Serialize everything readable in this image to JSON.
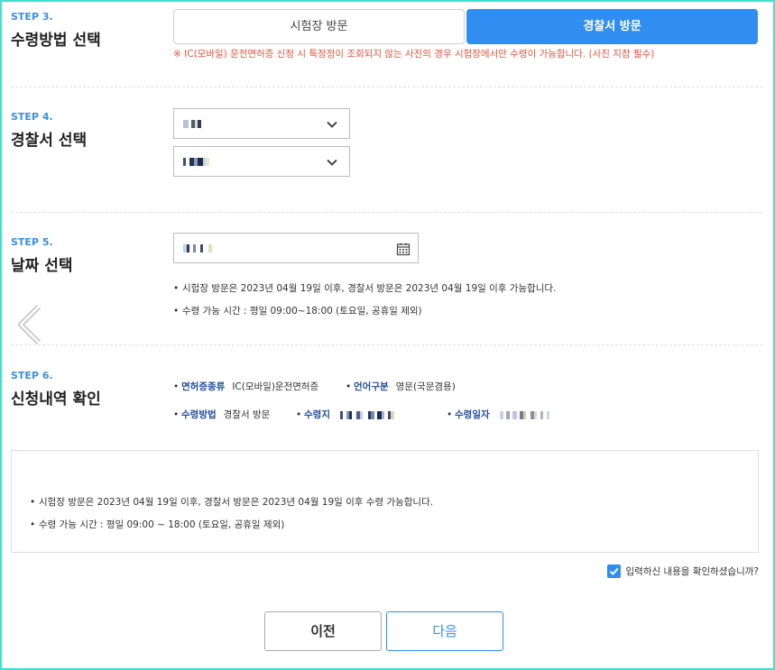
{
  "step3": {
    "label": "STEP 3.",
    "title": "수령방법 선택",
    "option_exam": "시험장 방문",
    "option_police": "경찰서 방문",
    "notice": "※ IC(모바일) 운전면허증 신청 시 특정점이 조회되지 않는 사진의 경우 시험장에서만 수령이 가능합니다. (사진 지참 필수)"
  },
  "step4": {
    "label": "STEP 4.",
    "title": "경찰서 선택"
  },
  "step5": {
    "label": "STEP 5.",
    "title": "날짜 선택",
    "info1": "시험장 방문은 2023년 04월 19일 이후, 경찰서 방문은 2023년 04월 19일 이후 가능합니다.",
    "info2": "수령 가능 시간 : 평일 09:00~18:00 (토요일, 공휴일 제외)"
  },
  "step6": {
    "label": "STEP 6.",
    "title": "신청내역 확인",
    "license_type_label": "면허증종류",
    "license_type_value": "IC(모바일)운전면허증",
    "language_label": "언어구분",
    "language_value": "영문(국문겸용)",
    "method_label": "수령방법",
    "method_value": "경찰서 방문",
    "place_label": "수령지",
    "date_label": "수령일자"
  },
  "notice_box": {
    "line1": "시험장 방문은 2023년 04월 19일 이후, 경찰서 방문은 2023년 04월 19일 이후 수령 가능합니다.",
    "line2": "수령 가능 시간 : 평일 09:00 ~ 18:00 (토요일, 공휴일 제외)"
  },
  "confirm_label": "입력하신 내용을 확인하셨습니까?",
  "buttons": {
    "prev": "이전",
    "next": "다음"
  },
  "colors": {
    "accent": "#2f8ef0",
    "step_label": "#3a8fe0",
    "notice_red": "#e8533a",
    "frame": "#3ee0cf"
  },
  "bullet": "•"
}
